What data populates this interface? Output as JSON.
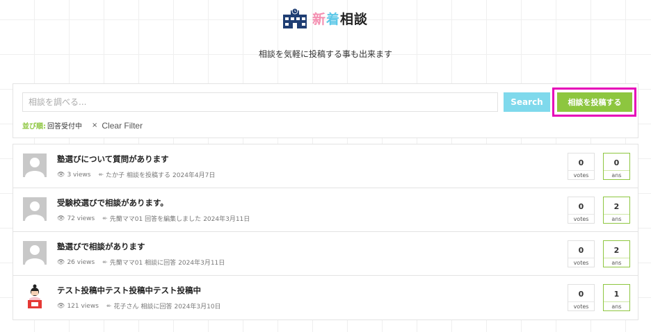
{
  "header": {
    "title_part1": "新",
    "title_part2": "着",
    "title_part3": "相談",
    "subtitle": "相談を気軽に投稿する事も出来ます"
  },
  "search": {
    "placeholder": "相談を調べる...",
    "button_label": "Search",
    "post_button_label": "相談を投稿する",
    "sort_label": "並び順:",
    "sort_value": "回答受付中",
    "clear_icon": "×",
    "clear_label": "Clear Filter"
  },
  "questions": [
    {
      "title": "塾選びについて質問があります",
      "views": "3 views",
      "user": "たか子",
      "action": "相談を投稿する",
      "date": "2024年4月7日",
      "votes": "0",
      "votes_label": "votes",
      "answers": "0",
      "answers_label": "ans",
      "avatar": "default-avatar"
    },
    {
      "title": "受験校選びで相談があります。",
      "views": "72 views",
      "user": "先蘭ママ01",
      "action": "回答を編集しました",
      "date": "2024年3月11日",
      "votes": "0",
      "votes_label": "votes",
      "answers": "2",
      "answers_label": "ans",
      "avatar": "default-avatar"
    },
    {
      "title": "塾選びで相談があります",
      "views": "26 views",
      "user": "先蘭ママ01",
      "action": "相談に回答",
      "date": "2024年3月11日",
      "votes": "0",
      "votes_label": "votes",
      "answers": "2",
      "answers_label": "ans",
      "avatar": "default-avatar"
    },
    {
      "title": "テスト投稿中テスト投稿中テスト投稿中",
      "views": "121 views",
      "user": "花子さん",
      "action": "相談に回答",
      "date": "2024年3月10日",
      "votes": "0",
      "votes_label": "votes",
      "answers": "1",
      "answers_label": "ans",
      "avatar": "illustrated-avatar"
    }
  ],
  "colors": {
    "accent_green": "#8dc63f",
    "accent_cyan": "#7fd9ec",
    "highlight_magenta": "#e600b8",
    "title_pink": "#f48fb1"
  }
}
